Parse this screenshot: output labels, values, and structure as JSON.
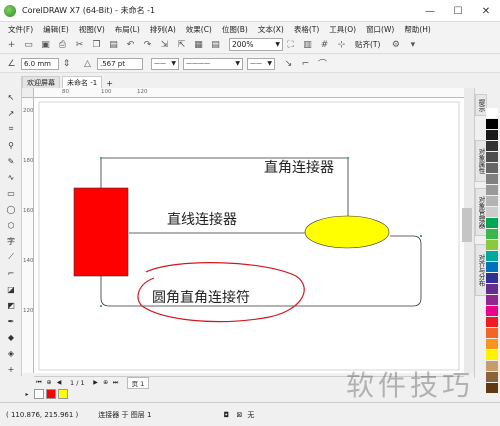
{
  "window": {
    "title": "CorelDRAW X7 (64-Bit) - 未命名 -1",
    "minimize": "—",
    "restore": "☐",
    "close": "✕"
  },
  "menu": [
    "文件(F)",
    "编辑(E)",
    "视图(V)",
    "布局(L)",
    "排列(A)",
    "效果(C)",
    "位图(B)",
    "文本(X)",
    "表格(T)",
    "工具(O)",
    "窗口(W)",
    "帮助(H)"
  ],
  "toolbar": {
    "zoom": "200%",
    "snap": "贴齐(T)"
  },
  "property_bar": {
    "size_value": "6.0 mm",
    "outline_width": ".567 pt"
  },
  "tabs": {
    "welcome": "欢迎屏幕",
    "document": "未命名 -1",
    "add": "+"
  },
  "ruler": {
    "h_labels": [
      "80",
      "100",
      "120"
    ],
    "v_labels": [
      "200",
      "180",
      "160",
      "140",
      "120"
    ]
  },
  "canvas": {
    "label_right_angle": "直角连接器",
    "label_straight": "直线连接器",
    "label_rounded": "圆角直角连接符",
    "fill_red": "#ff0000",
    "fill_yellow": "#ffff00"
  },
  "dock": {
    "tab1": "提示",
    "tab2": "对象属性",
    "tab3": "对象管理器",
    "tab4": "对齐与分布"
  },
  "palette_colors": [
    "#ffffff",
    "#000000",
    "#1a1a1a",
    "#333333",
    "#4d4d4d",
    "#666666",
    "#808080",
    "#999999",
    "#b3b3b3",
    "#cccccc",
    "#00a651",
    "#39b54a",
    "#8dc63f",
    "#00a99d",
    "#0072bc",
    "#2e3192",
    "#662d91",
    "#92278f",
    "#ec008c",
    "#ed1c24",
    "#f26522",
    "#f7941d",
    "#fff200",
    "#c69c6d",
    "#8c6239",
    "#603913"
  ],
  "doc_nav": {
    "page_count": "1 / 1",
    "page_tab": "页 1"
  },
  "status": {
    "coords": "( 110.876, 215.961 )",
    "description": "连接器 于 图层 1",
    "fill_none": "无"
  },
  "watermark": "软件技巧"
}
